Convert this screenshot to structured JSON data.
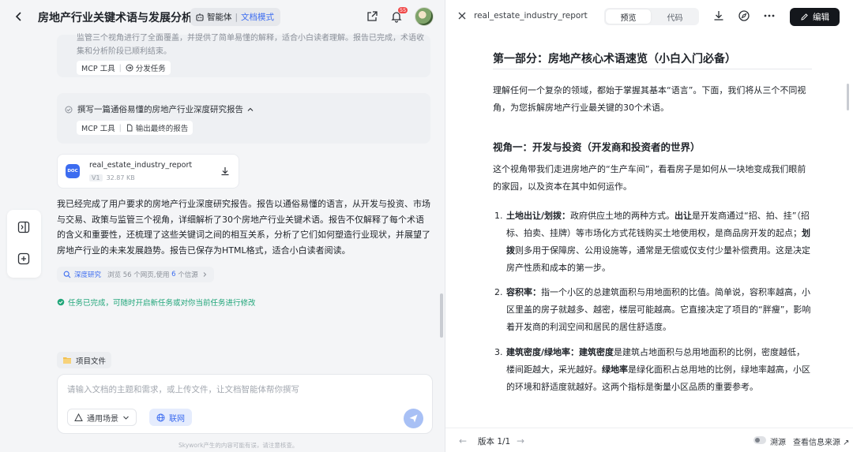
{
  "header": {
    "title": "房地产行业关键术语与发展分析",
    "agent_label": "智能体",
    "mode_label": "文档模式",
    "notification_count": "55"
  },
  "chat": {
    "faded_text": "监管三个视角进行了全面覆盖，并提供了简单易懂的解释，适合小白读者理解。报告已完成，术语收集和分析阶段已顺利结束。",
    "task1": {
      "tool_label": "MCP 工具",
      "action_label": "分发任务"
    },
    "task2": {
      "step_label": "撰写一篇通俗易懂的房地产行业深度研究报告",
      "tool_label": "MCP 工具",
      "action_label": "输出最终的报告"
    },
    "file": {
      "badge": "DOC",
      "name": "real_estate_industry_report",
      "version": "V1",
      "size": "32.87 KB"
    },
    "answer": "我已经完成了用户要求的房地产行业深度研究报告。报告以通俗易懂的语言，从开发与投资、市场与交易、政策与监管三个视角，详细解析了30个房地产行业关键术语。报告不仅解释了每个术语的含义和重要性，还梳理了这些关键词之间的相互关系，分析了它们如何塑造行业现状，并展望了房地产行业的未来发展趋势。报告已保存为HTML格式，适合小白读者阅读。",
    "research": {
      "label": "深度研究",
      "prefix": "浏览 56 个网页,使用",
      "count": "6",
      "suffix": "个信源"
    },
    "done_text": "任务已完成，可随时开启新任务或对你当前任务进行修改"
  },
  "composer": {
    "project_files_label": "项目文件",
    "placeholder": "请输入文档的主题和需求，或上传文件，让文档智能体帮你撰写",
    "scene_label": "通用场景",
    "network_label": "联网",
    "footnote": "Skywork产生的内容可能有误，请注意核查。"
  },
  "preview": {
    "file_name": "real_estate_industry_report",
    "tabs": [
      "预览",
      "代码"
    ],
    "active_tab": 0,
    "edit_label": "编辑",
    "section_title": "第一部分：房地产核心术语速览（小白入门必备）",
    "intro": "理解任何一个复杂的领域，都始于掌握其基本“语言”。下面，我们将从三个不同视角，为您拆解房地产行业最关键的30个术语。",
    "view1_title": "视角一：开发与投资（开发商和投资者的世界）",
    "view1_intro": "这个视角带我们走进房地产的“生产车间”，看看房子是如何从一块地变成我们眼前的家园，以及资本在其中如何运作。",
    "items": [
      {
        "num": "1.",
        "term": "土地出让/划拨：",
        "p1": "政府供应土地的两种方式。",
        "b1": "出让",
        "p2": "是开发商通过“招、拍、挂”（招标、拍卖、挂牌）等市场化方式花钱购买土地使用权，是商品房开发的起点；",
        "b2": "划拨",
        "p3": "则多用于保障房、公用设施等，通常是无偿或仅支付少量补偿费用。这是决定房产性质和成本的第一步。"
      },
      {
        "num": "2.",
        "term": "容积率：",
        "p1": "指一个小区的总建筑面积与用地面积的比值。简单说，容积率越高，小区里盖的房子就越多、越密，楼层可能越高。它直接决定了项目的“胖瘦”，影响着开发商的利润空间和居民的居住舒适度。"
      },
      {
        "num": "3.",
        "term": "建筑密度/绿地率：",
        "b1": "建筑密度",
        "p1": "是建筑占地面积与总用地面积的比例，密度越低，楼间距越大，采光越好。",
        "b2": "绿地率",
        "p2": "是绿化面积占总用地的比例，绿地率越高，小区的环境和舒适度就越好。这两个指标是衡量小区品质的重要参考。"
      }
    ],
    "footer": {
      "page_label": "版本 1/1",
      "trace_label": "溯源",
      "source_label": "查看信息来源 ↗"
    }
  }
}
